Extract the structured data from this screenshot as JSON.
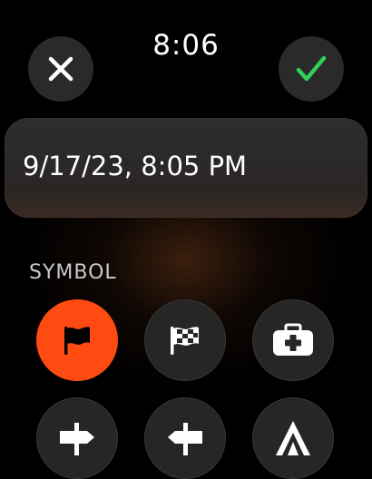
{
  "header": {
    "time": "8:06",
    "close_icon": "xmark-icon",
    "confirm_icon": "checkmark-icon",
    "confirm_color": "#30d158"
  },
  "date_field": {
    "value": "9/17/23, 8:05 PM"
  },
  "symbol_section": {
    "label": "SYMBOL",
    "accent_color": "#ff4a12",
    "selected": "flag-icon",
    "symbols": [
      "flag-icon",
      "checkered-flag-icon",
      "first-aid-kit-icon",
      "signpost-right-icon",
      "signpost-left-icon",
      "tent-icon"
    ]
  }
}
